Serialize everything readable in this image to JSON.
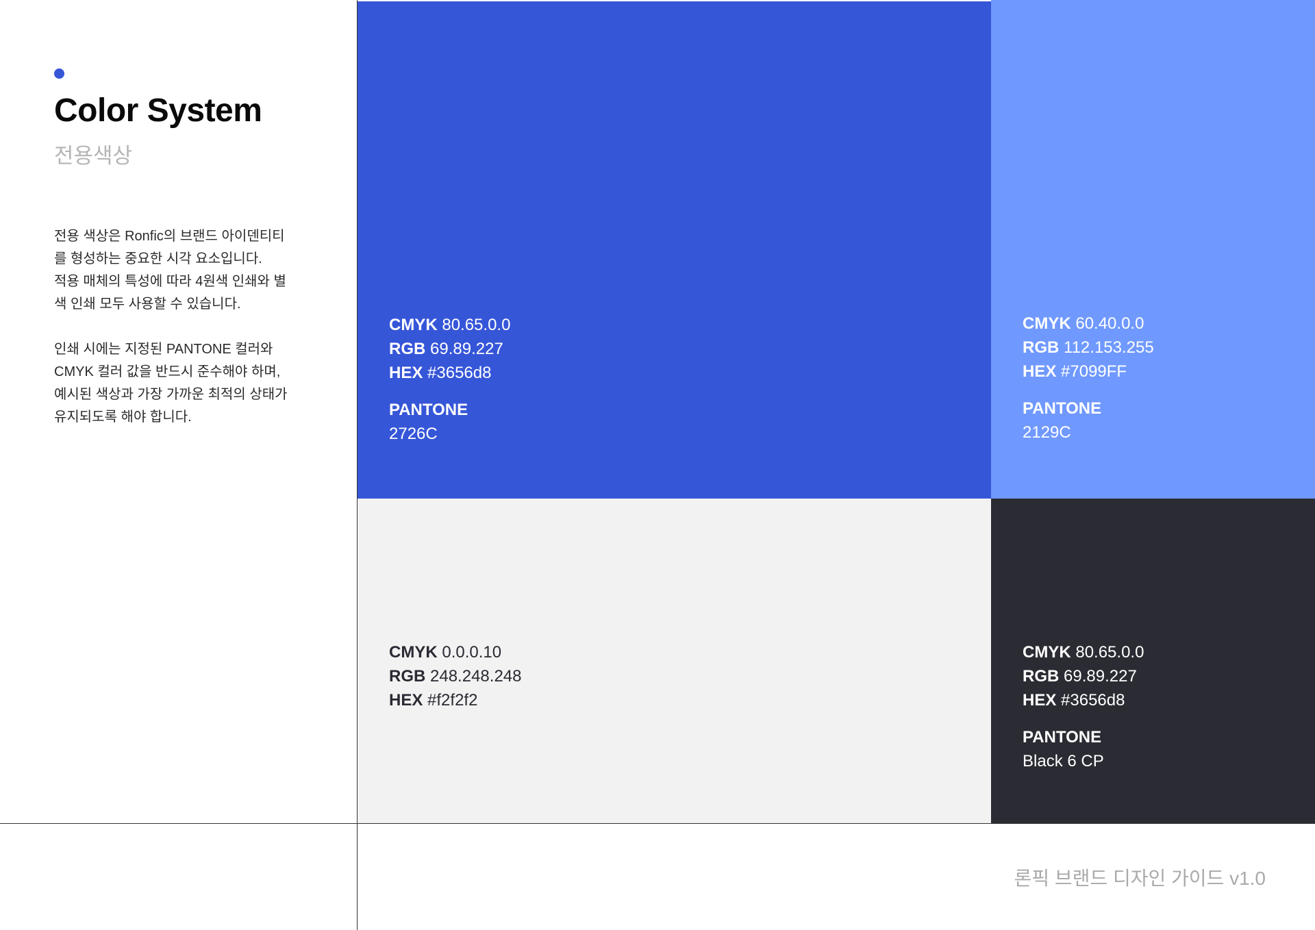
{
  "heading": {
    "title": "Color System",
    "subtitle": "전용색상",
    "accent_color": "#3656d8"
  },
  "description": {
    "paragraph1": "전용 색상은 Ronfic의 브랜드 아이덴티티\n를 형성하는 중요한 시각 요소입니다.\n적용 매체의 특성에 따라 4원색 인쇄와 별\n색 인쇄 모두 사용할 수 있습니다.",
    "paragraph2": "인쇄 시에는 지정된 PANTONE 컬러와\nCMYK 컬러 값을 반드시 준수해야 하며,\n예시된 색상과 가장 가까운 최적의 상태가\n유지되도록 해야 합니다."
  },
  "labels": {
    "cmyk": "CMYK",
    "rgb": "RGB",
    "hex": "HEX",
    "pantone": "PANTONE"
  },
  "swatches": {
    "primary": {
      "fill": "#3656d8",
      "text_color": "#ffffff",
      "cmyk": "80.65.0.0",
      "rgb": "69.89.227",
      "hex": "#3656d8",
      "pantone": "2726C"
    },
    "secondary": {
      "fill": "#7099ff",
      "text_color": "#ffffff",
      "cmyk": "60.40.0.0",
      "rgb": "112.153.255",
      "hex": "#7099FF",
      "pantone": "2129C"
    },
    "light": {
      "fill": "#f2f2f2",
      "text_color": "#2a2a33",
      "cmyk": "0.0.0.10",
      "rgb": "248.248.248",
      "hex": "#f2f2f2"
    },
    "dark": {
      "fill": "#2b2c33",
      "text_color": "#ffffff",
      "cmyk": "80.65.0.0",
      "rgb": "69.89.227",
      "hex": "#3656d8",
      "pantone": "Black 6 CP"
    }
  },
  "footer": {
    "text": "론픽 브랜드 디자인 가이드 v1.0"
  }
}
